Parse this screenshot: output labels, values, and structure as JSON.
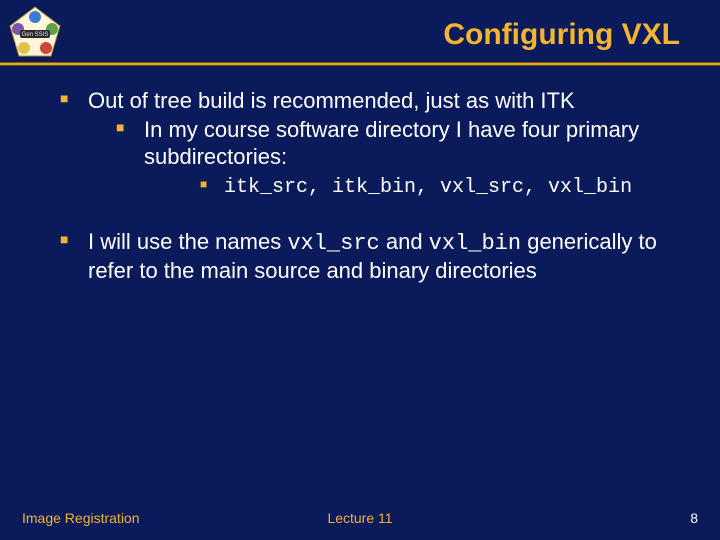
{
  "header": {
    "title": "Configuring VXL"
  },
  "bullets": {
    "b1": "Out of tree build is recommended, just as with ITK",
    "b2": "In my course software directory I have four primary subdirectories:",
    "b3": "itk_src, itk_bin, vxl_src, vxl_bin",
    "b4_pre": "I will use the names ",
    "b4_m1": "vxl_src",
    "b4_mid": " and ",
    "b4_m2": "vxl_bin",
    "b4_post": " generically to refer to the main source and binary directories"
  },
  "footer": {
    "left": "Image Registration",
    "center": "Lecture 11",
    "right": "8"
  },
  "logo_label": "Gen SSIS"
}
